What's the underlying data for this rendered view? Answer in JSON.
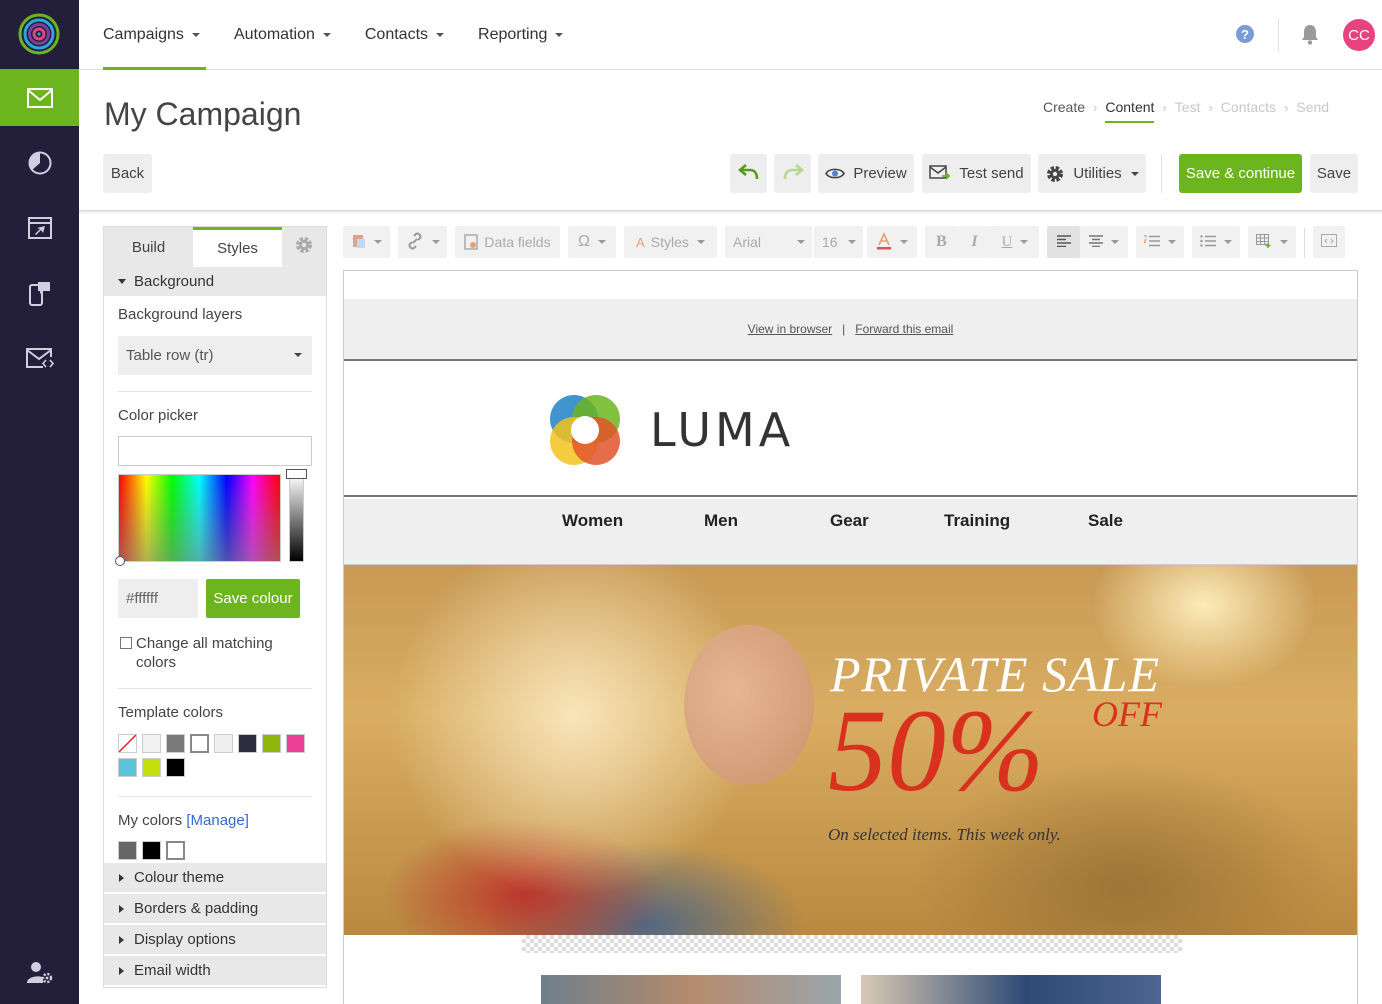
{
  "app": {
    "avatar_initials": "CC",
    "accent_color": "#6cb51f",
    "rail_color": "#231f3b"
  },
  "rail": {
    "items": [
      {
        "icon": "envelope-icon",
        "active": true
      },
      {
        "icon": "pie-chart-icon",
        "active": false
      },
      {
        "icon": "automation-icon",
        "active": false
      },
      {
        "icon": "mobile-message-icon",
        "active": false
      },
      {
        "icon": "email-code-icon",
        "active": false
      },
      {
        "icon": "user-settings-icon",
        "active": false
      }
    ]
  },
  "topnav": {
    "menu": [
      {
        "label": "Campaigns",
        "active": true
      },
      {
        "label": "Automation",
        "active": false
      },
      {
        "label": "Contacts",
        "active": false
      },
      {
        "label": "Reporting",
        "active": false
      }
    ],
    "help_glyph": "?"
  },
  "header": {
    "title": "My Campaign",
    "steps": [
      {
        "label": "Create",
        "state": "done"
      },
      {
        "label": "Content",
        "state": "active"
      },
      {
        "label": "Test",
        "state": "disabled"
      },
      {
        "label": "Contacts",
        "state": "disabled"
      },
      {
        "label": "Send",
        "state": "disabled"
      }
    ],
    "back_label": "Back",
    "preview_label": "Preview",
    "test_send_label": "Test send",
    "utilities_label": "Utilities",
    "save_continue_label": "Save & continue",
    "save_label": "Save"
  },
  "panel": {
    "tabs": {
      "build": "Build",
      "styles": "Styles"
    },
    "background_section": "Background",
    "background_layers_label": "Background layers",
    "background_layers_value": "Table row (tr)",
    "color_picker_label": "Color picker",
    "hex_value": "#ffffff",
    "save_colour_label": "Save colour",
    "change_all_label": "Change all matching colors",
    "template_colors_label": "Template colors",
    "template_colors": [
      "none",
      "#f2f2f2",
      "#7a7a7a",
      "#ffffff",
      "#efefef",
      "#2d2d3d",
      "#8fb50c",
      "#ec3f96",
      "#5bc5d8",
      "#c4e00c",
      "#000000"
    ],
    "my_colors_label": "My colors",
    "manage_label": "[Manage]",
    "my_colors": [
      "#666666",
      "#000000",
      "#ffffff"
    ],
    "collapsed_sections": [
      "Colour theme",
      "Borders & padding",
      "Display options",
      "Email width"
    ]
  },
  "toolbar": {
    "data_fields_label": "Data fields",
    "omega_glyph": "Ω",
    "styles_label": "Styles",
    "font_family": "Arial",
    "font_size": "16",
    "bold_glyph": "B",
    "italic_glyph": "I",
    "underline_glyph": "U"
  },
  "email": {
    "view_in_browser": "View in browser",
    "forward": "Forward this email",
    "separator": "|",
    "brand": "LUMA",
    "nav": [
      "Women",
      "Men",
      "Gear",
      "Training",
      "Sale"
    ],
    "hero_title": "PRIVATE SALE",
    "hero_percent": "50%",
    "hero_off": "OFF",
    "hero_sub": "On selected items. This week only."
  }
}
